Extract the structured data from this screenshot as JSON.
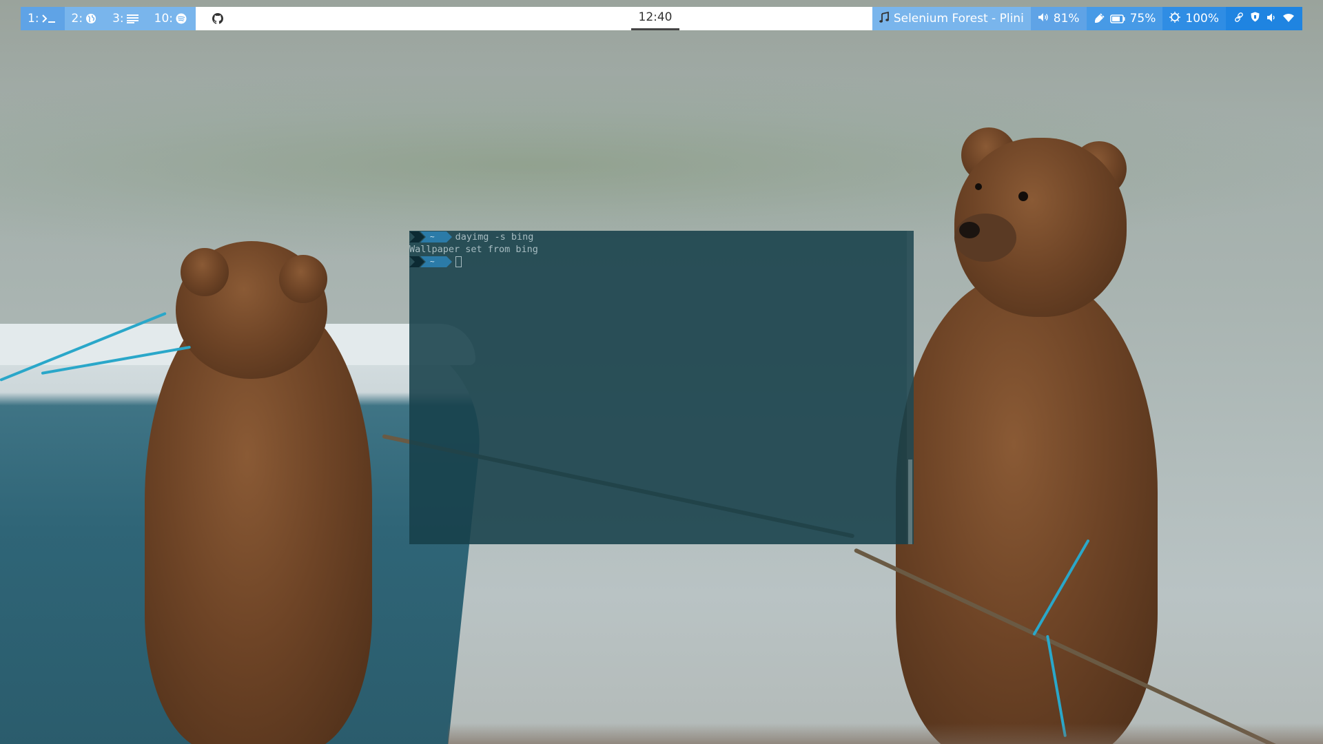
{
  "topbar": {
    "workspaces": [
      {
        "label": "1:",
        "icon": "terminal-icon",
        "active": true
      },
      {
        "label": "2:",
        "icon": "globe-icon",
        "active": false
      },
      {
        "label": "3:",
        "icon": "text-lines-icon",
        "active": false
      },
      {
        "label": "10:",
        "icon": "spotify-icon",
        "active": false
      }
    ],
    "github_icon": "github-icon",
    "clock": "12:40",
    "music": {
      "icon": "music-note-icon",
      "text": "Selenium Forest - Plini"
    },
    "volume": {
      "icon": "speaker-icon",
      "text": "81%"
    },
    "battery": {
      "icon": "plug-battery-icon",
      "text": "75%"
    },
    "brightness": {
      "icon": "brightness-icon",
      "text": "100%"
    },
    "tray": [
      "link-icon",
      "shield-icon",
      "volume-tray-icon",
      "wifi-icon"
    ],
    "colors": {
      "workspace_bg": "#79b5ec",
      "workspace_active_bg": "#5fa3e6",
      "center_bg": "#ffffff",
      "tray_bg": "#1f84e1"
    }
  },
  "terminal": {
    "prompt_dir": "~",
    "lines": [
      {
        "type": "command",
        "text": "dayimg -s bing"
      },
      {
        "type": "output",
        "text": "Wallpaper set from bing"
      },
      {
        "type": "prompt",
        "text": ""
      }
    ],
    "scroll_fraction": 0.27,
    "colors": {
      "background": "#17404a",
      "text": "#a8bdc2",
      "prompt_segment": "#2b7ba8"
    }
  }
}
